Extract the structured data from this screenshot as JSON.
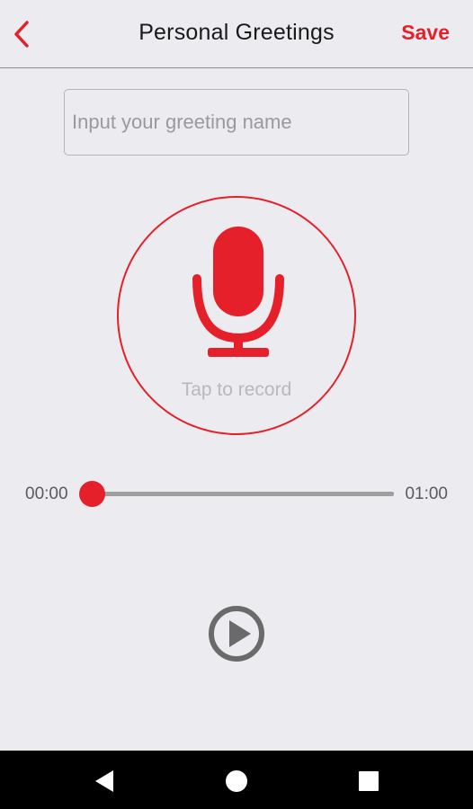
{
  "header": {
    "title": "Personal Greetings",
    "save_label": "Save",
    "back_icon": "chevron-left-icon"
  },
  "greeting_input": {
    "placeholder": "Input your greeting name",
    "value": ""
  },
  "recorder": {
    "label": "Tap to record",
    "icon": "microphone-icon"
  },
  "playback": {
    "current_time": "00:00",
    "total_time": "01:00",
    "progress": 0.0,
    "play_icon": "play-icon"
  },
  "navbar": {
    "back_icon": "triangle-back-icon",
    "home_icon": "circle-home-icon",
    "recents_icon": "square-recents-icon"
  },
  "colors": {
    "accent": "#e5202a",
    "background": "#ebebf0",
    "navbar": "#000000",
    "play_icon": "#6a6a6a"
  }
}
